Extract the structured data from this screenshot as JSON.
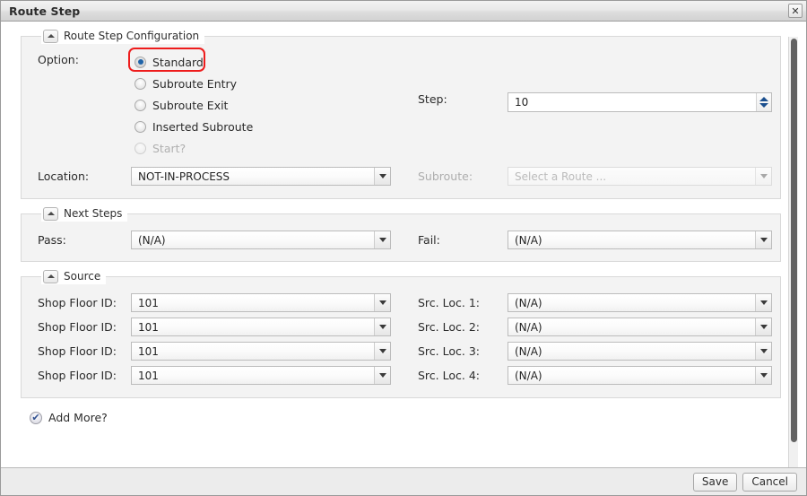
{
  "window": {
    "title": "Route Step",
    "close_icon": "close-icon"
  },
  "sections": {
    "config": {
      "legend": "Route Step Configuration",
      "option_label": "Option:",
      "options": [
        {
          "label": "Standard",
          "checked": true,
          "disabled": false,
          "highlighted": true
        },
        {
          "label": "Subroute Entry",
          "checked": false,
          "disabled": false,
          "highlighted": false
        },
        {
          "label": "Subroute Exit",
          "checked": false,
          "disabled": false,
          "highlighted": false
        },
        {
          "label": "Inserted Subroute",
          "checked": false,
          "disabled": false,
          "highlighted": false
        },
        {
          "label": "Start?",
          "checked": false,
          "disabled": true,
          "highlighted": false
        }
      ],
      "step_label": "Step:",
      "step_value": "10",
      "location_label": "Location:",
      "location_value": "NOT-IN-PROCESS",
      "subroute_label": "Subroute:",
      "subroute_value": "Select a Route ...",
      "subroute_disabled": true
    },
    "next_steps": {
      "legend": "Next Steps",
      "pass_label": "Pass:",
      "pass_value": "(N/A)",
      "fail_label": "Fail:",
      "fail_value": "(N/A)"
    },
    "source": {
      "legend": "Source",
      "rows": [
        {
          "shop_floor_label": "Shop Floor ID:",
          "shop_floor_value": "101",
          "src_loc_label": "Src. Loc. 1:",
          "src_loc_value": "(N/A)"
        },
        {
          "shop_floor_label": "Shop Floor ID:",
          "shop_floor_value": "101",
          "src_loc_label": "Src. Loc. 2:",
          "src_loc_value": "(N/A)"
        },
        {
          "shop_floor_label": "Shop Floor ID:",
          "shop_floor_value": "101",
          "src_loc_label": "Src. Loc. 3:",
          "src_loc_value": "(N/A)"
        },
        {
          "shop_floor_label": "Shop Floor ID:",
          "shop_floor_value": "101",
          "src_loc_label": "Src. Loc. 4:",
          "src_loc_value": "(N/A)"
        }
      ]
    }
  },
  "add_more": {
    "label": "Add More?",
    "checked": true,
    "check_glyph": "✔"
  },
  "footer": {
    "save_label": "Save",
    "cancel_label": "Cancel"
  },
  "colors": {
    "highlight": "#ee1c1c",
    "radio_dot": "#1f63a8",
    "spinner_arrow": "#1b4f8e",
    "panel_bg": "#f3f3f3",
    "titlebar_bg": "#e6e6e6",
    "footer_bg": "#ececec"
  }
}
